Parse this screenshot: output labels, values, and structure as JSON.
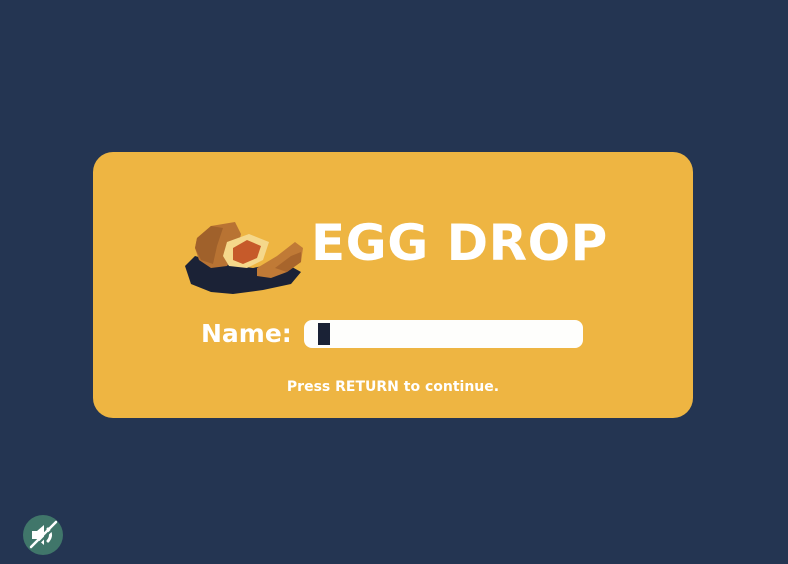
{
  "game": {
    "title": "EGG DROP",
    "name_label": "Name:",
    "name_value": "",
    "hint": "Press RETURN to continue."
  },
  "colors": {
    "background": "#243552",
    "card": "#EEB542",
    "text": "#FFFFFF",
    "input": "#FEFEFC",
    "cursor": "#1A2236",
    "mute_button": "#40766A"
  },
  "icons": {
    "logo": "cracked-egg-nest-icon",
    "mute": "speaker-muted-icon"
  }
}
